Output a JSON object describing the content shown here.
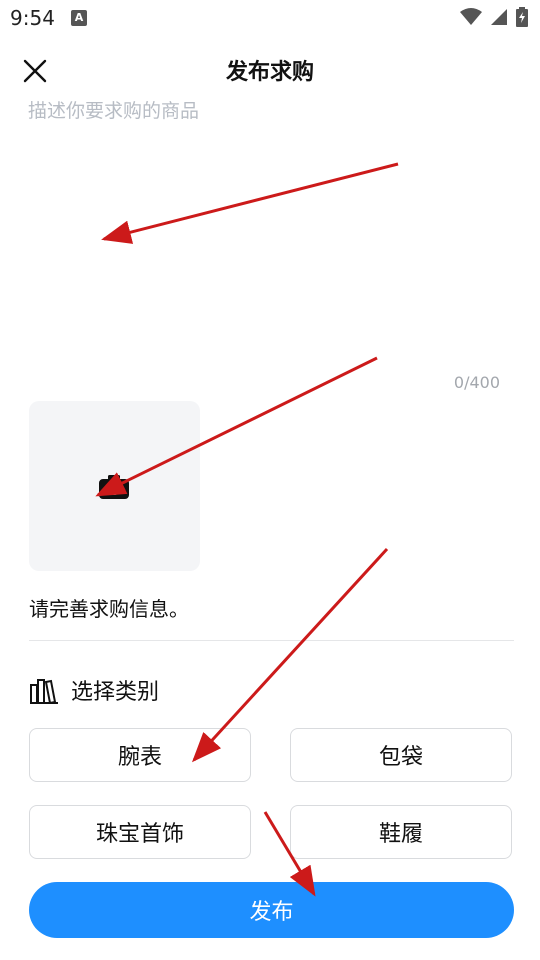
{
  "status_bar": {
    "time": "9:54",
    "app_icon_label": "A"
  },
  "header": {
    "title": "发布求购"
  },
  "description": {
    "placeholder": "描述你要求购的商品",
    "value": "",
    "char_count": "0/400"
  },
  "photo": {
    "icon": "camera-icon"
  },
  "hint": {
    "text": "请完善求购信息。"
  },
  "category": {
    "title": "选择类别",
    "icon": "books-icon",
    "options": [
      "腕表",
      "包袋",
      "珠宝首饰",
      "鞋履"
    ]
  },
  "publish": {
    "label": "发布"
  },
  "colors": {
    "accent": "#1e8fff",
    "annotation": "#cc1a1a"
  }
}
